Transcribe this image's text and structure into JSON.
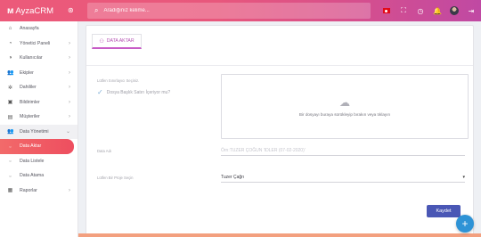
{
  "brand": {
    "logo": "ᴍ",
    "name": "AyzaCRM",
    "toggle_icon": "⊛"
  },
  "search": {
    "icon": "⌕",
    "placeholder": "Aradığınız kelime..."
  },
  "top_icons": [
    {
      "name": "tr-flag-icon"
    },
    {
      "name": "fullscreen-icon",
      "glyph": "⛶"
    },
    {
      "name": "clock-icon",
      "glyph": "◷"
    },
    {
      "name": "bell-icon",
      "glyph": "🔔"
    },
    {
      "name": "avatar"
    },
    {
      "name": "logout-icon",
      "glyph": "⇥"
    }
  ],
  "sidebar": {
    "items": [
      {
        "label": "Anasayfa",
        "icon": "⌂",
        "chevron": ""
      },
      {
        "label": "Yönetici Paneli",
        "icon": "◔",
        "chevron": "›"
      },
      {
        "label": "Kullanıcılar",
        "icon": "◑",
        "chevron": "›"
      },
      {
        "label": "Ekipler",
        "icon": "👥",
        "chevron": "›"
      },
      {
        "label": "Dahililer",
        "icon": "✲",
        "chevron": "›"
      },
      {
        "label": "Bildirimler",
        "icon": "▣",
        "chevron": "›"
      },
      {
        "label": "Müşteriler",
        "icon": "▤",
        "chevron": "›"
      },
      {
        "label": "Data Yönetimi",
        "icon": "👥",
        "chevron": "⌄"
      },
      {
        "label": "Data Aktar",
        "icon": "○",
        "chevron": ""
      },
      {
        "label": "Data Listele",
        "icon": "○",
        "chevron": ""
      },
      {
        "label": "Data Atama",
        "icon": "○",
        "chevron": ""
      },
      {
        "label": "Raporlar",
        "icon": "▦",
        "chevron": "›"
      }
    ]
  },
  "tab": {
    "icon": "⚇",
    "label": "DATA AKTAR"
  },
  "form": {
    "delimiter_label": "Lütfen Sınırlayıcı Seçiniz.",
    "header_check_icon": "✓",
    "header_check_label": "Dosya Başlık Satırı İçeriyor mu?",
    "dropzone_icon": "☁",
    "dropzone_text": "Bir dosyayı buraya sürükleyip bırakın veya tıklayın",
    "data_name_label": "Data Adı",
    "data_name_placeholder": "Örn:TUZER ÇOĞUN 'IDLER (07-02-2020)'",
    "project_label": "Lütfen Bir Proje Seçin",
    "project_value": "Tuzer Çağrı",
    "project_arrow": "▾",
    "save_label": "Kaydet"
  },
  "fab": {
    "label": "+"
  },
  "colors": {
    "accent": "#e8577c",
    "active": "#ee4e5f",
    "save": "#4a57b5",
    "fab": "#2e93d6"
  }
}
